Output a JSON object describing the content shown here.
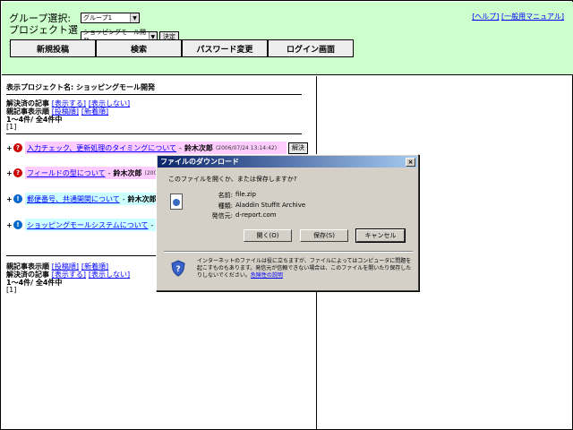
{
  "header": {
    "group_label": "グループ選択:",
    "group_value": "グループ1",
    "project_label": "プロジェクト選択:",
    "project_value": "ショッピングモール開発",
    "decide_button": "決定",
    "link_help": "[ヘルプ]",
    "link_manual": "[一般用マニュアル]",
    "nav": [
      "新規投稿",
      "検索",
      "パスワード変更",
      "ログイン画面"
    ]
  },
  "left": {
    "project_line": "表示プロジェクト名: ショッピングモール開発",
    "resolved_label": "解決済の記事",
    "show": "[表示する]",
    "hide": "[表示しない]",
    "parent_order_label": "親記事表示順",
    "order_post": "[投稿順]",
    "order_new": "[新着順]",
    "count": "1～4件/  全4件中",
    "page": "[1]",
    "items": [
      {
        "title": "入力チェック、更新処理のタイミングについて",
        "author": "鈴木次郎",
        "date": "(2006/07/24 13:14:42)",
        "resolve": "解決",
        "color": "#ffccff",
        "icon_color": "#cc0000",
        "icon": "?"
      },
      {
        "title": "フィールドの型について",
        "author": "鈴木次郎",
        "date": "(2006",
        "color": "#ffccff",
        "icon_color": "#cc0000",
        "icon": "?"
      },
      {
        "title": "郵便番号、共通開関について",
        "author": "鈴木次郎",
        "color": "#ccffff",
        "icon_color": "#0066cc",
        "icon": "!"
      },
      {
        "title": "ショッピングモールシステムについて",
        "author": "山",
        "color": "#ccffff",
        "icon_color": "#0066cc",
        "icon": "!"
      }
    ],
    "separator": "-"
  },
  "dialog": {
    "title": "ファイルのダウンロード",
    "close": "×",
    "question": "このファイルを開くか、または保存しますか?",
    "name_label": "名前:",
    "name_value": "file.zip",
    "type_label": "種類:",
    "type_value": "Aladdin StuffIt Archive",
    "from_label": "発信元:",
    "from_value": "d-report.com",
    "open_button": "開く(O)",
    "save_button": "保存(S)",
    "cancel_button": "キャンセル",
    "warning": "インターネットのファイルは役に立ちますが、ファイルによってはコンピュータに問題を起こすものもあります。発信元が信頼できない場合は、このファイルを開いたり保存したりしないでください。",
    "risk_link": "危険性の説明"
  }
}
